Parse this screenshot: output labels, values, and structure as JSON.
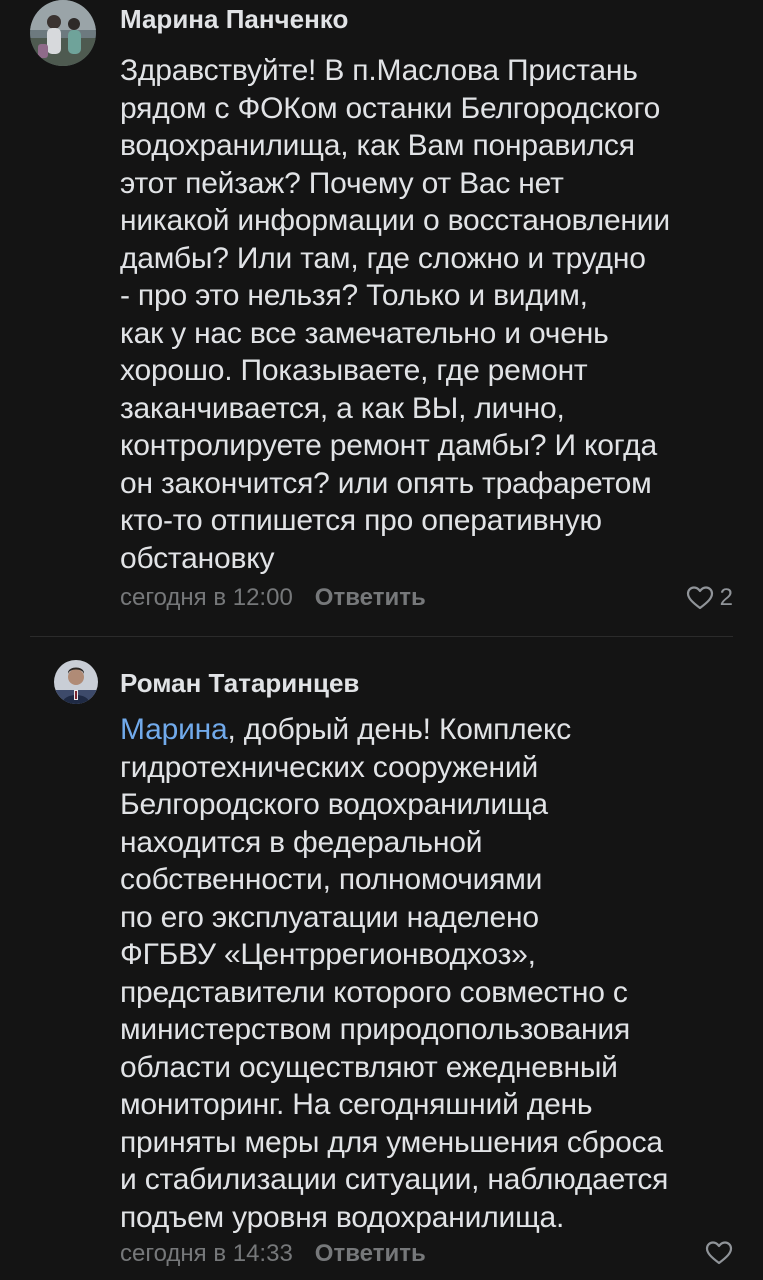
{
  "comments": [
    {
      "author": "Марина Панченко",
      "lines": [
        "Здравствуйте! В п.Маслова Пристань",
        "рядом с ФОКом останки Белгородского",
        "водохранилища, как Вам понравился",
        "этот пейзаж? Почему от Вас нет",
        "никакой информации о восстановлении",
        "дамбы? Или там, где сложно и трудно",
        "- про это нельзя? Только и видим,",
        "как у нас все замечательно и очень",
        "хорошо. Показываете, где ремонт",
        "заканчивается, а как ВЫ, лично,",
        "контролируете ремонт дамбы? И когда",
        "он закончится? или опять трафаретом",
        "кто-то отпишется про оперативную",
        "обстановку"
      ],
      "time": "сегодня в 12:00",
      "reply_label": "Ответить",
      "likes": "2",
      "like_icon": "heart-outline-icon"
    },
    {
      "author": "Роман Татаринцев",
      "mention": "Марина",
      "first_line_rest": ", добрый день! Комплекс",
      "lines": [
        "гидротехнических сооружений",
        "Белгородского водохранилища",
        "находится в федеральной",
        "собственности, полномочиями",
        "по его эксплуатации наделено",
        "ФГБВУ «Центррегионводхоз»,",
        "представители которого совместно с",
        "министерством природопользования",
        "области осуществляют ежедневный",
        "мониторинг. На сегодняшний день",
        "приняты меры для уменьшения сброса",
        "и стабилизации ситуации, наблюдается",
        "подъем уровня водохранилища."
      ],
      "time": "сегодня в 14:33",
      "reply_label": "Ответить",
      "like_icon": "heart-outline-icon"
    }
  ],
  "colors": {
    "background": "#141414",
    "text": "#e1e3e6",
    "secondary": "#76787a",
    "mention": "#71aaeb"
  }
}
